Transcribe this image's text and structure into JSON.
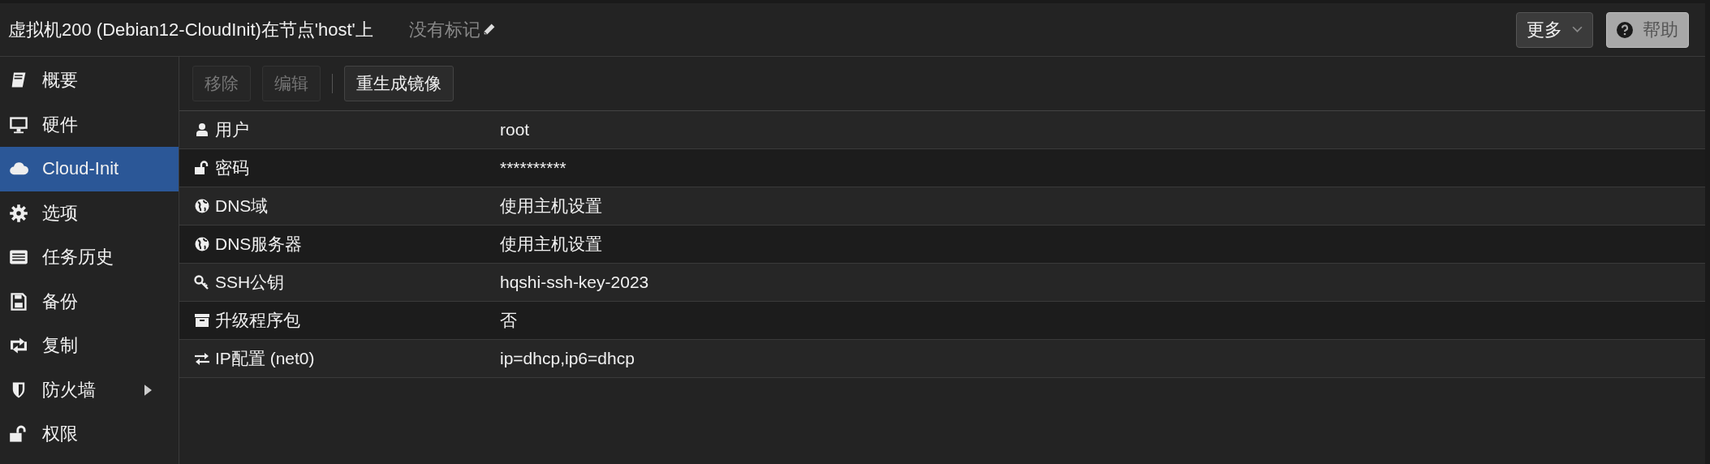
{
  "header": {
    "title": "虚拟机200 (Debian12-CloudInit)在节点'host'上",
    "tags": "没有标记",
    "more_button": "更多",
    "help_button": "帮助"
  },
  "sidebar": {
    "items": [
      {
        "label": "概要",
        "kind": "book",
        "selected": false,
        "has_submenu": false
      },
      {
        "label": "硬件",
        "kind": "monitor",
        "selected": false,
        "has_submenu": false
      },
      {
        "label": "Cloud-Init",
        "kind": "cloud",
        "selected": true,
        "has_submenu": false
      },
      {
        "label": "选项",
        "kind": "gear",
        "selected": false,
        "has_submenu": false
      },
      {
        "label": "任务历史",
        "kind": "list",
        "selected": false,
        "has_submenu": false
      },
      {
        "label": "备份",
        "kind": "floppy",
        "selected": false,
        "has_submenu": false
      },
      {
        "label": "复制",
        "kind": "retweet",
        "selected": false,
        "has_submenu": false
      },
      {
        "label": "防火墙",
        "kind": "shield",
        "selected": false,
        "has_submenu": true
      },
      {
        "label": "权限",
        "kind": "unlock",
        "selected": false,
        "has_submenu": false
      }
    ]
  },
  "toolbar": {
    "buttons": [
      {
        "label": "移除",
        "disabled": true
      },
      {
        "label": "编辑",
        "disabled": true
      },
      {
        "label": "重生成镜像",
        "disabled": false
      }
    ]
  },
  "table": {
    "rows": [
      {
        "kind": "user",
        "name": "用户",
        "value": "root"
      },
      {
        "kind": "unlock",
        "name": "密码",
        "value": "**********"
      },
      {
        "kind": "globe",
        "name": "DNS域",
        "value": "使用主机设置"
      },
      {
        "kind": "globe",
        "name": "DNS服务器",
        "value": "使用主机设置"
      },
      {
        "kind": "key",
        "name": "SSH公钥",
        "value": "hqshi-ssh-key-2023"
      },
      {
        "kind": "archive",
        "name": "升级程序包",
        "value": "否"
      },
      {
        "kind": "exchange",
        "name": "IP配置 (net0)",
        "value": "ip=dhcp,ip6=dhcp"
      }
    ]
  }
}
